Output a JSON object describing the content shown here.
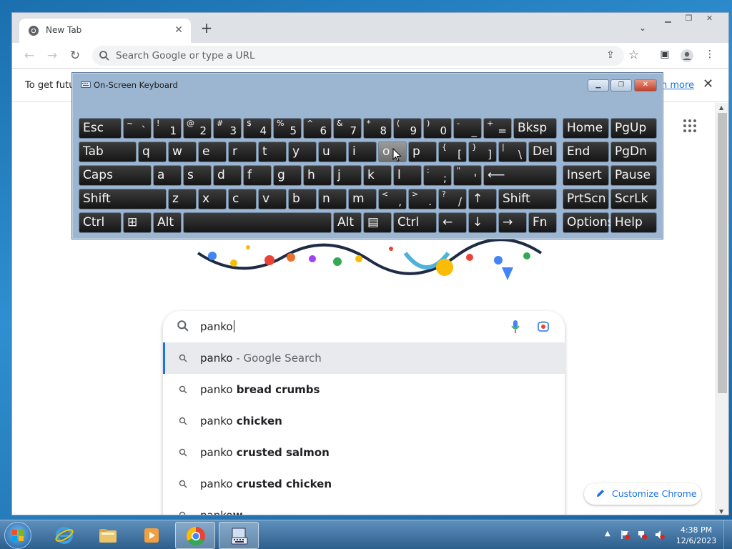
{
  "browser": {
    "tab_title": "New Tab",
    "omnibox_placeholder": "Search Google or type a URL"
  },
  "infobar": {
    "text": "To get futur",
    "link": "n more"
  },
  "osk": {
    "title": "On-Screen Keyboard",
    "rows": [
      [
        {
          "main": "Esc",
          "w": 60
        },
        {
          "shift": "~",
          "base": "`",
          "w": 40
        },
        {
          "shift": "!",
          "base": "1",
          "w": 40
        },
        {
          "shift": "@",
          "base": "2",
          "w": 40
        },
        {
          "shift": "#",
          "base": "3",
          "w": 40
        },
        {
          "shift": "$",
          "base": "4",
          "w": 40
        },
        {
          "shift": "%",
          "base": "5",
          "w": 40
        },
        {
          "shift": "^",
          "base": "6",
          "w": 40
        },
        {
          "shift": "&",
          "base": "7",
          "w": 40
        },
        {
          "shift": "*",
          "base": "8",
          "w": 40
        },
        {
          "shift": "(",
          "base": "9",
          "w": 40
        },
        {
          "shift": ")",
          "base": "0",
          "w": 40
        },
        {
          "shift": "-",
          "base": "_",
          "w": 40
        },
        {
          "shift": "+",
          "base": "=",
          "w": 40
        },
        {
          "main": "Bksp",
          "w": 61
        },
        {
          "main": "Home",
          "w": 65,
          "gap": 6
        },
        {
          "main": "PgUp",
          "w": 65
        }
      ],
      [
        {
          "main": "Tab",
          "w": 81
        },
        {
          "main": "q",
          "w": 40
        },
        {
          "main": "w",
          "w": 40
        },
        {
          "main": "e",
          "w": 40
        },
        {
          "main": "r",
          "w": 40
        },
        {
          "main": "t",
          "w": 40
        },
        {
          "main": "y",
          "w": 40
        },
        {
          "main": "u",
          "w": 40
        },
        {
          "main": "i",
          "w": 40
        },
        {
          "main": "o",
          "w": 40,
          "hover": true
        },
        {
          "main": "p",
          "w": 40
        },
        {
          "shift": "{",
          "base": "[",
          "w": 40
        },
        {
          "shift": "}",
          "base": "]",
          "w": 40
        },
        {
          "shift": "|",
          "base": "\\",
          "w": 40
        },
        {
          "main": "Del",
          "w": 40
        },
        {
          "main": "End",
          "w": 65,
          "gap": 6
        },
        {
          "main": "PgDn",
          "w": 65
        }
      ],
      [
        {
          "main": "Caps",
          "w": 102
        },
        {
          "main": "a",
          "w": 40
        },
        {
          "main": "s",
          "w": 40
        },
        {
          "main": "d",
          "w": 40
        },
        {
          "main": "f",
          "w": 40
        },
        {
          "main": "g",
          "w": 40
        },
        {
          "main": "h",
          "w": 40
        },
        {
          "main": "j",
          "w": 40
        },
        {
          "main": "k",
          "w": 40
        },
        {
          "main": "l",
          "w": 40
        },
        {
          "shift": ":",
          "base": ";",
          "w": 40
        },
        {
          "shift": "\"",
          "base": "'",
          "w": 40
        },
        {
          "main": "⟵",
          "w": 103
        },
        {
          "main": "Insert",
          "w": 65,
          "gap": 6
        },
        {
          "main": "Pause",
          "w": 65
        }
      ],
      [
        {
          "main": "Shift",
          "w": 123
        },
        {
          "main": "z",
          "w": 40
        },
        {
          "main": "x",
          "w": 40
        },
        {
          "main": "c",
          "w": 40
        },
        {
          "main": "v",
          "w": 40
        },
        {
          "main": "b",
          "w": 40
        },
        {
          "main": "n",
          "w": 40
        },
        {
          "main": "m",
          "w": 40
        },
        {
          "shift": "<",
          "base": ",",
          "w": 40
        },
        {
          "shift": ">",
          "base": ".",
          "w": 40
        },
        {
          "shift": "?",
          "base": "/",
          "w": 40
        },
        {
          "main": "↑",
          "w": 40
        },
        {
          "main": "Shift",
          "w": 82
        },
        {
          "main": "PrtScn",
          "w": 65,
          "gap": 6
        },
        {
          "main": "ScrLk",
          "w": 65
        }
      ],
      [
        {
          "main": "Ctrl",
          "w": 60
        },
        {
          "main": "⊞",
          "w": 40
        },
        {
          "main": "Alt",
          "w": 40
        },
        {
          "main": " ",
          "w": 208
        },
        {
          "main": "Alt",
          "w": 40
        },
        {
          "main": "▤",
          "w": 40
        },
        {
          "main": "Ctrl",
          "w": 61
        },
        {
          "main": "←",
          "w": 40
        },
        {
          "main": "↓",
          "w": 40
        },
        {
          "main": "→",
          "w": 40
        },
        {
          "main": "Fn",
          "w": 40
        },
        {
          "main": "Options",
          "w": 65,
          "gap": 6
        },
        {
          "main": "Help",
          "w": 65
        }
      ]
    ]
  },
  "search": {
    "query": "panko",
    "suggestions": [
      {
        "prefix": "panko",
        "rest": " - Google Search",
        "selected": true
      },
      {
        "prefix": "panko",
        "rest": " bread crumbs"
      },
      {
        "prefix": "panko",
        "rest": " chicken"
      },
      {
        "prefix": "panko",
        "rest": " crusted salmon"
      },
      {
        "prefix": "panko",
        "rest": " crusted chicken"
      },
      {
        "prefix": "panko",
        "rest": "w"
      }
    ]
  },
  "customize_label": "Customize Chrome",
  "taskbar": {
    "time": "4:38 PM",
    "date": "12/6/2023"
  },
  "colors": {
    "accent": "#1a73e8",
    "osk_bg": "#9cb6d2",
    "key_bg": "#1e1e1e",
    "taskbar": "#3f72a4"
  }
}
